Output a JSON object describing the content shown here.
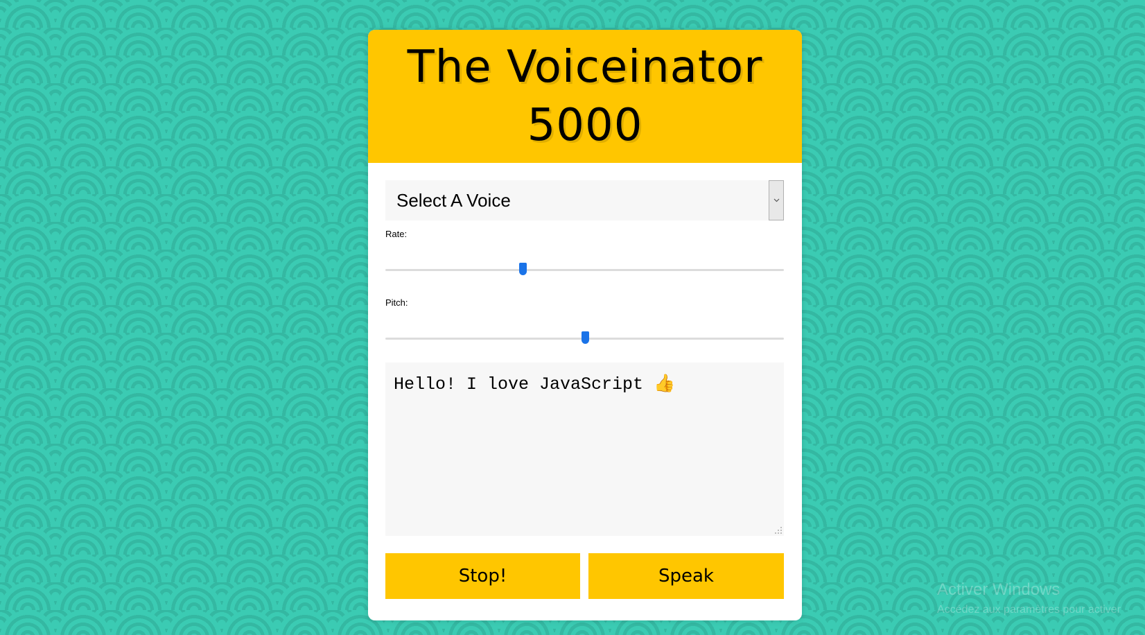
{
  "app": {
    "title_line1": "The Voiceinator",
    "title_line2": "5000"
  },
  "voice_select": {
    "selected": "Select A Voice",
    "arrow_icon": "chevron-down-icon"
  },
  "rate": {
    "label": "Rate:",
    "value_fraction": 0.345
  },
  "pitch": {
    "label": "Pitch:",
    "value_fraction": 0.5
  },
  "text_input": {
    "value": "Hello! I love JavaScript 👍"
  },
  "buttons": {
    "stop": "Stop!",
    "speak": "Speak"
  },
  "watermark": {
    "title": "Activer Windows",
    "subtitle": "Accédez aux paramètres pour activer"
  },
  "colors": {
    "accent": "#ffc600",
    "background": "#3bcbb3",
    "slider_thumb": "#1a73e8"
  }
}
